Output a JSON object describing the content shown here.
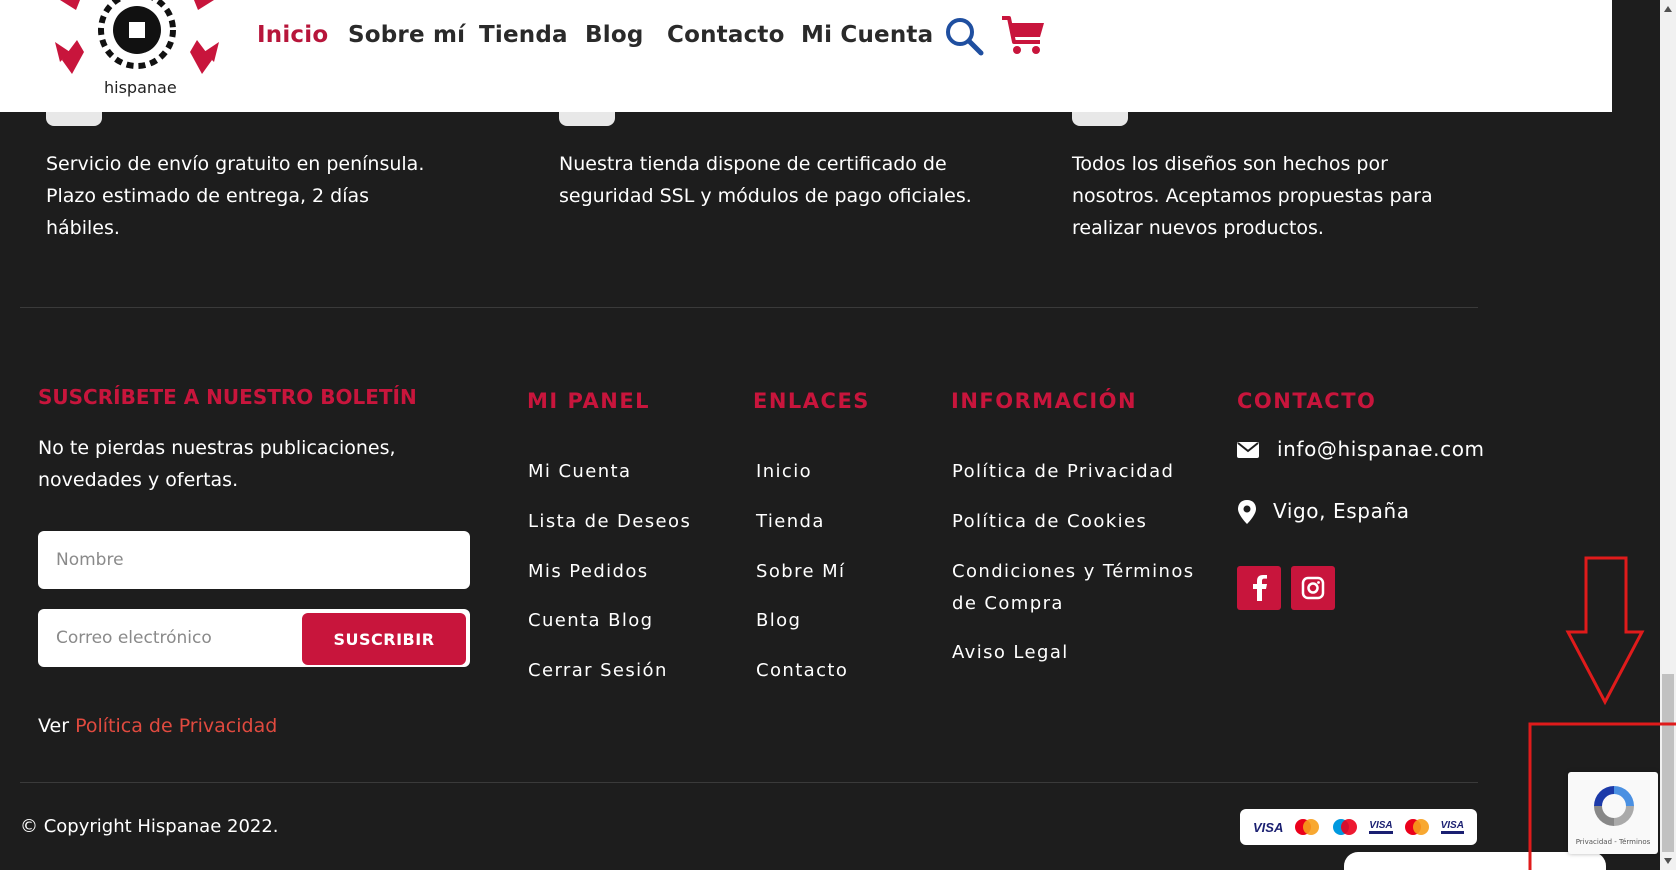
{
  "header": {
    "logo_text": "hispanae",
    "nav": [
      {
        "label": "Inicio",
        "active": true
      },
      {
        "label": "Sobre mí"
      },
      {
        "label": "Tienda"
      },
      {
        "label": "Blog"
      },
      {
        "label": "Contacto"
      },
      {
        "label": "Mi Cuenta"
      }
    ],
    "icons": [
      "search-icon",
      "cart-icon"
    ]
  },
  "features": [
    {
      "text": "Servicio de envío gratuito en península. Plazo estimado de entrega, 2 días hábiles."
    },
    {
      "text": "Nuestra tienda dispone de certificado de seguridad SSL y módulos de pago oficiales."
    },
    {
      "text": "Todos los diseños son hechos por nosotros. Aceptamos propuestas para realizar nuevos productos."
    }
  ],
  "newsletter": {
    "heading": "SUSCRÍBETE A NUESTRO BOLETÍN",
    "description": "No te pierdas nuestras publicaciones, novedades y ofertas.",
    "name_placeholder": "Nombre",
    "email_placeholder": "Correo electrónico",
    "subscribe_label": "SUSCRIBIR",
    "privacy_prefix": "Ver",
    "privacy_link": "Política de Privacidad"
  },
  "mi_panel": {
    "heading": "MI PANEL",
    "links": [
      "Mi Cuenta",
      "Lista de Deseos",
      "Mis Pedidos",
      "Cuenta Blog",
      "Cerrar Sesión"
    ]
  },
  "enlaces": {
    "heading": "ENLACES",
    "links": [
      "Inicio",
      "Tienda",
      "Sobre Mí",
      "Blog",
      "Contacto"
    ]
  },
  "informacion": {
    "heading": "INFORMACIÓN",
    "links": [
      "Política de Privacidad",
      "Política de Cookies",
      "Condiciones y Términos de Compra",
      "Aviso Legal"
    ]
  },
  "contacto": {
    "heading": "CONTACTO",
    "email": "info@hispanae.com",
    "location": "Vigo, España",
    "social": [
      "facebook-icon",
      "instagram-icon"
    ]
  },
  "copyright": "© Copyright Hispanae 2022.",
  "payments": [
    "VISA",
    "mastercard-icon",
    "maestro-icon",
    "VISA",
    "mastercard-icon",
    "VISA"
  ],
  "recaptcha": {
    "text": "Privacidad - Términos"
  },
  "colors": {
    "accent": "#c8153c",
    "background": "#1d1d1d",
    "annotation": "#e01b1b"
  }
}
